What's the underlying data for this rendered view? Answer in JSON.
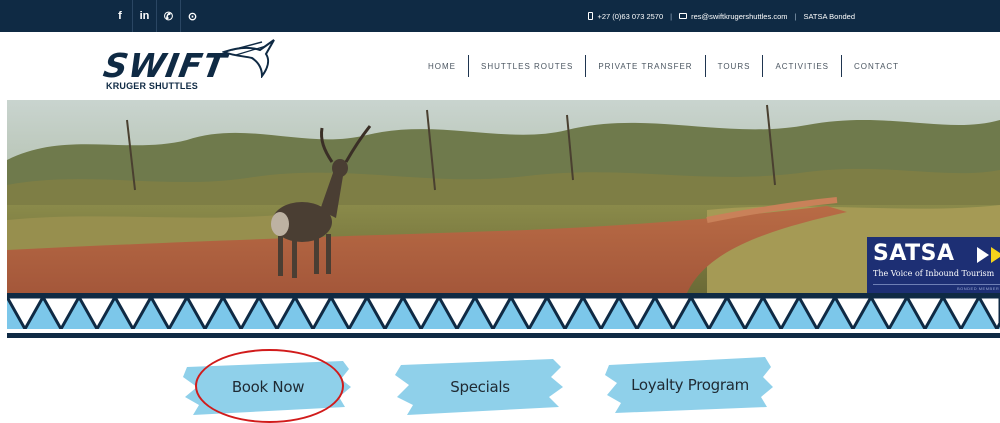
{
  "topbar": {
    "social": [
      {
        "icon": "facebook-icon",
        "glyph": "f"
      },
      {
        "icon": "linkedin-icon",
        "glyph": "in"
      },
      {
        "icon": "whatsapp-icon",
        "glyph": "✆"
      },
      {
        "icon": "tripadvisor-icon",
        "glyph": "⊙"
      }
    ],
    "phone": "+27 (0)63 073 2570",
    "separator": "|",
    "email": "res@swiftkrugershuttles.com",
    "membership": "SATSA Bonded"
  },
  "logo": {
    "word": "SWIFT",
    "subtitle": "KRUGER SHUTTLES"
  },
  "nav": {
    "items": [
      "HOME",
      "SHUTTLES ROUTES",
      "PRIVATE TRANSFER",
      "TOURS",
      "ACTIVITIES",
      "CONTACT"
    ]
  },
  "satsa_badge": {
    "title": "SATSA",
    "tagline": "The Voice of Inbound Tourism",
    "bonded": "BONDED MEMBER"
  },
  "buttons": {
    "book_now": "Book Now",
    "specials": "Specials",
    "loyalty": "Loyalty Program"
  },
  "colors": {
    "navy": "#0f2a44",
    "button_blue": "#8fd0ea",
    "pattern_light": "#ffffff",
    "pattern_blue": "#7cc7ea",
    "highlight": "#d11b1b"
  }
}
